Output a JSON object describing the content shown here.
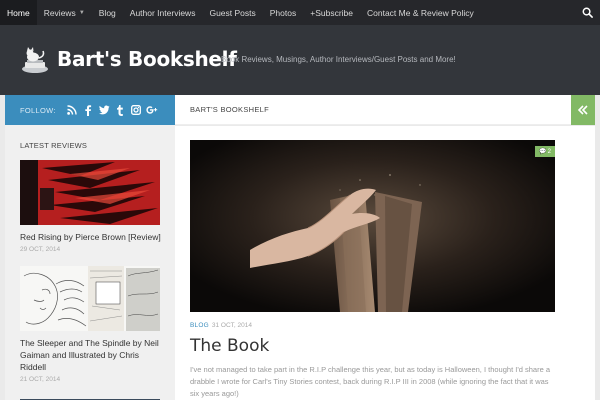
{
  "topnav": {
    "items": [
      {
        "label": "Home"
      },
      {
        "label": "Reviews"
      },
      {
        "label": "Blog"
      },
      {
        "label": "Author Interviews"
      },
      {
        "label": "Guest Posts"
      },
      {
        "label": "Photos"
      },
      {
        "label": "+Subscribe"
      },
      {
        "label": "Contact Me & Review Policy"
      }
    ]
  },
  "header": {
    "title": "Bart's Bookshelf",
    "tagline": "Book Reviews, Musings, Author Interviews/Guest Posts and More!"
  },
  "follow": {
    "label": "FOLLOW:",
    "icons": [
      "rss-icon",
      "facebook-icon",
      "twitter-icon",
      "tumblr-icon",
      "instagram-icon",
      "google-plus-icon"
    ]
  },
  "breadcrumb": {
    "label": "BART'S BOOKSHELF"
  },
  "sidebar": {
    "heading": "LATEST REVIEWS",
    "posts": [
      {
        "title": "Red Rising by Pierce Brown [Review]",
        "date": "29 OCT, 2014"
      },
      {
        "title": "The Sleeper and The Spindle by Neil Gaiman and Illustrated by Chris Riddell",
        "date": "21 OCT, 2014"
      }
    ]
  },
  "post": {
    "category": "BLOG",
    "date": "31 OCT, 2014",
    "title": "The Book",
    "excerpt": "I've not managed to take part in the R.I.P challenge this year, but as today is Halloween, I thought I'd share a drabble I wrote for Carl's Tiny Stories contest, back during R.I.P III in 2008 (while ignoring the fact that it was six years ago!)",
    "comments": "2"
  },
  "colors": {
    "nav_bg": "#26272b",
    "header_bg": "#33363b",
    "follow_bg": "#3b8dbd",
    "accent_green": "#82b965"
  }
}
